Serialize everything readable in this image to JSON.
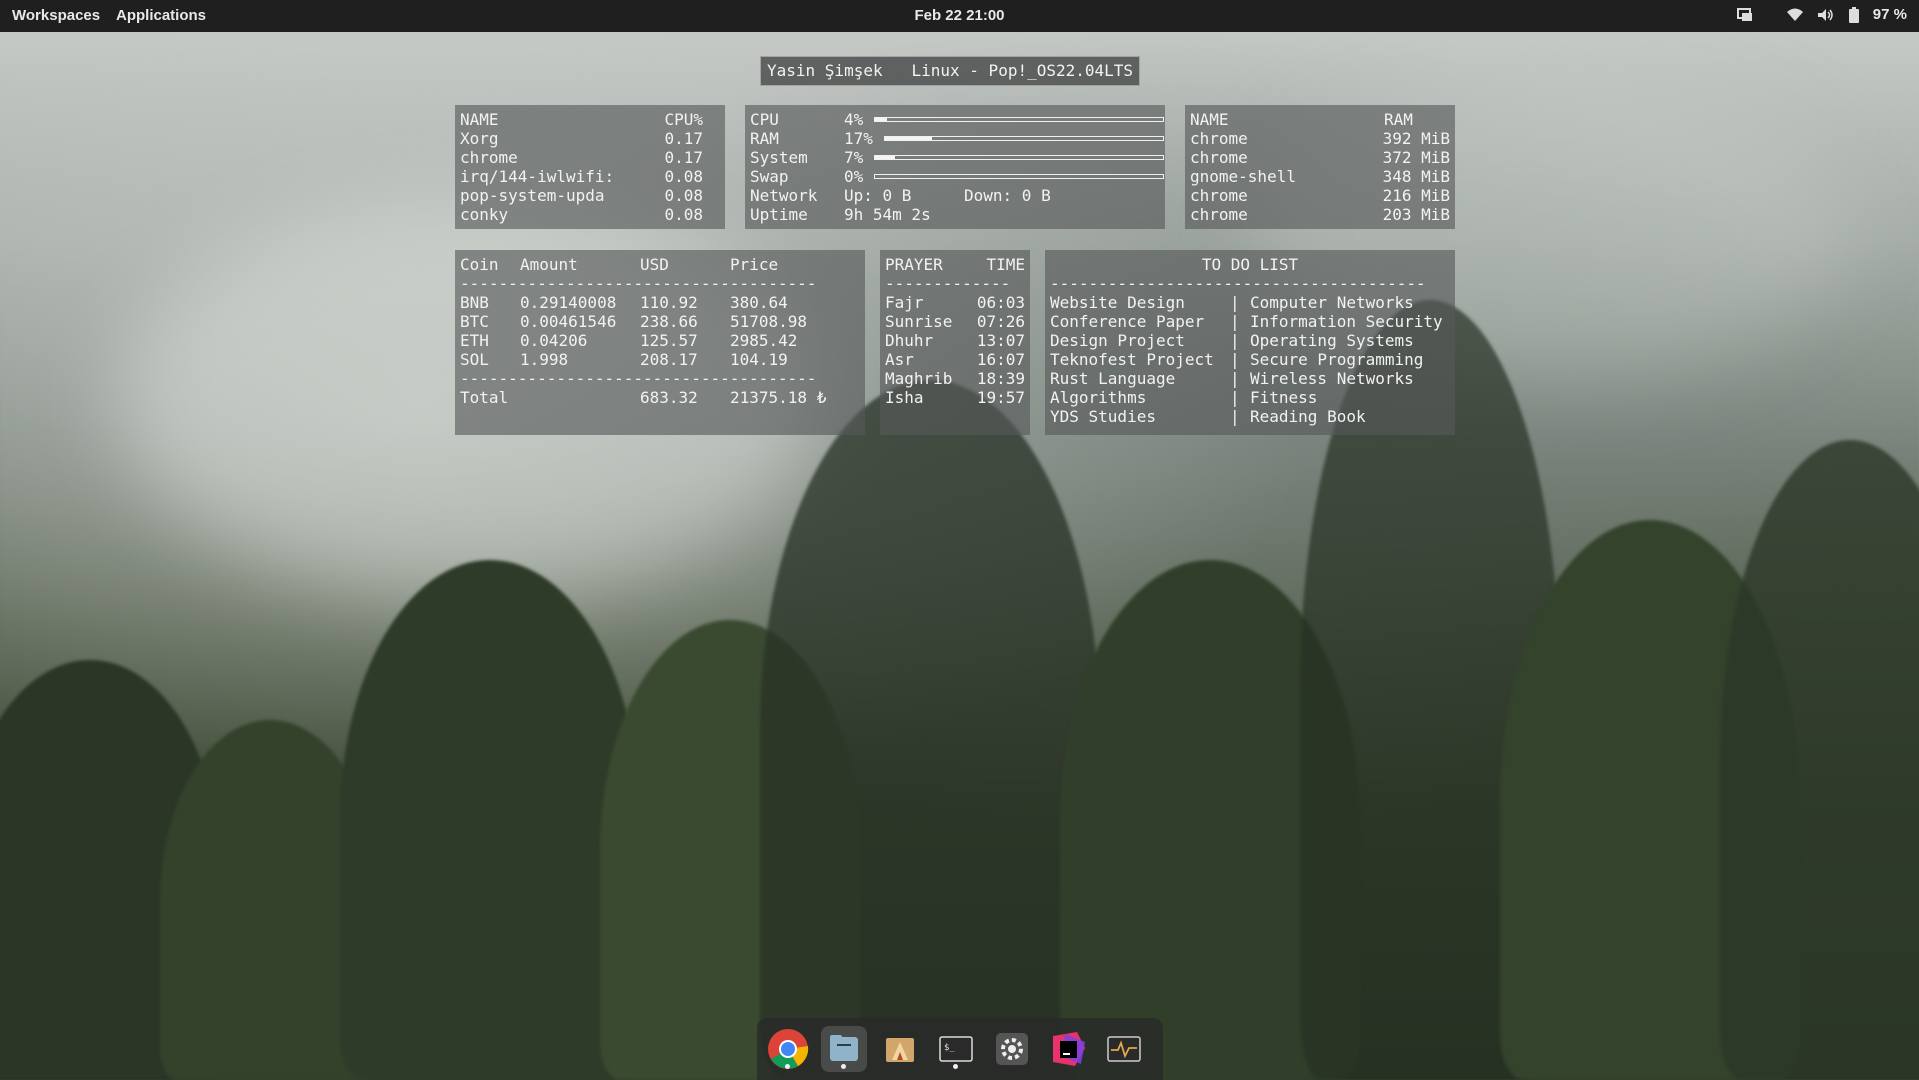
{
  "topbar": {
    "workspaces": "Workspaces",
    "applications": "Applications",
    "clock": "Feb 22  21:00",
    "battery": "97 %"
  },
  "header": {
    "title": "Yasin Şimşek   Linux - Pop!_OS22.04LTS"
  },
  "cpu_procs": {
    "headers": [
      "NAME",
      "CPU%"
    ],
    "rows": [
      [
        "Xorg",
        "0.17"
      ],
      [
        "chrome",
        "0.17"
      ],
      [
        "irq/144-iwlwifi:",
        "0.08"
      ],
      [
        "pop-system-upda",
        "0.08"
      ],
      [
        "conky",
        "0.08"
      ]
    ]
  },
  "system": {
    "cpu": {
      "label": "CPU",
      "value": "4%",
      "fill": 0.04
    },
    "ram": {
      "label": "RAM",
      "value": "17%",
      "fill": 0.17
    },
    "sys": {
      "label": "System",
      "value": "7%",
      "fill": 0.07
    },
    "swap": {
      "label": "Swap",
      "value": "0%",
      "fill": 0.0
    },
    "network": {
      "label": "Network",
      "up": "Up: 0 B",
      "down": "Down: 0 B"
    },
    "uptime": {
      "label": "Uptime",
      "value": "9h 54m 2s"
    }
  },
  "ram_procs": {
    "headers": [
      "NAME",
      "RAM"
    ],
    "rows": [
      [
        "chrome",
        "392 MiB"
      ],
      [
        "chrome",
        "372 MiB"
      ],
      [
        "gnome-shell",
        "348 MiB"
      ],
      [
        "chrome",
        "216 MiB"
      ],
      [
        "chrome",
        "203 MiB"
      ]
    ]
  },
  "crypto": {
    "headers": [
      "Coin",
      "Amount",
      "USD",
      "Price"
    ],
    "divider": "-------------------------------------",
    "rows": [
      [
        "BNB",
        "0.29140008",
        "110.92",
        "380.64"
      ],
      [
        "BTC",
        "0.00461546",
        "238.66",
        "51708.98"
      ],
      [
        "ETH",
        "0.04206",
        "125.57",
        "2985.42"
      ],
      [
        "SOL",
        "1.998",
        "208.17",
        "104.19"
      ]
    ],
    "total_label": "Total",
    "total_usd": "683.32",
    "total_price": "21375.18 ₺"
  },
  "prayer": {
    "headers": [
      "PRAYER",
      "TIME"
    ],
    "divider": "-------------",
    "rows": [
      [
        "Fajr",
        "06:03"
      ],
      [
        "Sunrise",
        "07:26"
      ],
      [
        "Dhuhr",
        "13:07"
      ],
      [
        "Asr",
        "16:07"
      ],
      [
        "Maghrib",
        "18:39"
      ],
      [
        "Isha",
        "19:57"
      ]
    ]
  },
  "todo": {
    "title": "TO DO LIST",
    "divider": "---------------------------------------",
    "left": [
      "Website Design",
      "Conference Paper",
      "Design Project",
      "Teknofest Project",
      "Rust Language",
      "Algorithms",
      "YDS Studies"
    ],
    "right": [
      "Computer Networks",
      "Information Security",
      "Operating Systems",
      "Secure Programming",
      "Wireless Networks",
      "Fitness",
      "Reading Book"
    ],
    "sep": "|"
  },
  "dock": {
    "apps": [
      "chrome-icon",
      "files-icon",
      "installer-icon",
      "terminal-icon",
      "settings-icon",
      "jetbrains-icon",
      "system-monitor-icon"
    ]
  }
}
